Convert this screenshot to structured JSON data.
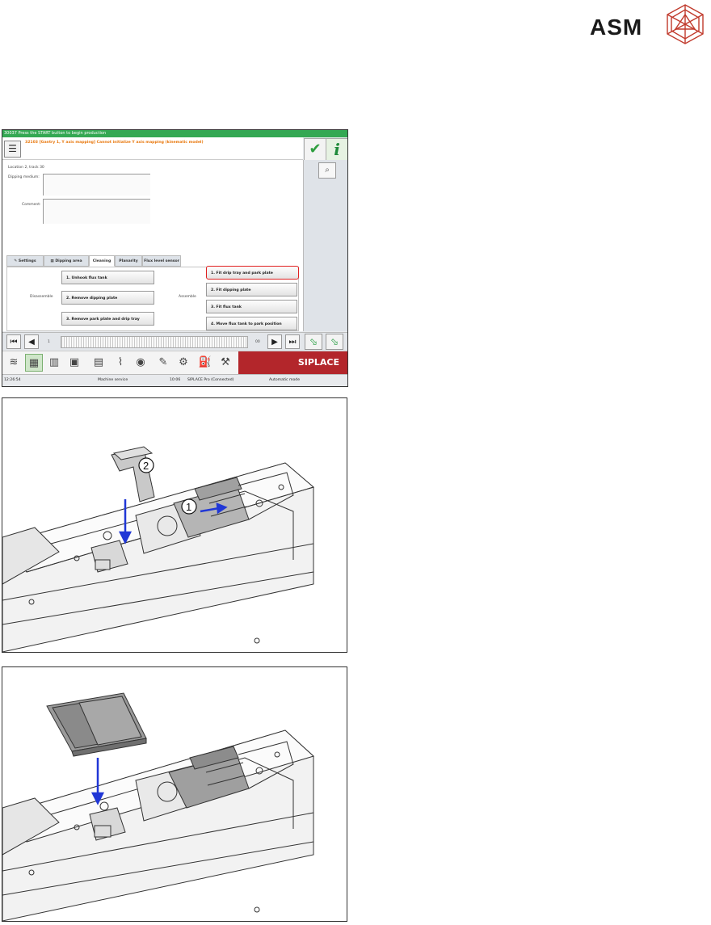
{
  "brand": {
    "name": "ASM",
    "logo_icon": "asm-logo-icon"
  },
  "screen": {
    "status_line": "30037 Press the START button to begin production",
    "message": "32103 [Gantry 1, Y axis mapping] Cannot initialize Y axis mapping (kinematic model)",
    "menu_icon": "hamburger-icon",
    "ok_icon": "check-icon",
    "info_label": "i",
    "zoom_icon": "magnifier-icon",
    "location": "Location 2, track 30",
    "dipping_medium_label": "Dipping medium:",
    "comment_label": "Comment:",
    "tabs": [
      {
        "label": "Settings",
        "icon": "wrench-icon"
      },
      {
        "label": "Dipping area",
        "icon": "tray-icon"
      },
      {
        "label": "Cleaning",
        "active": true
      },
      {
        "label": "Planarity"
      },
      {
        "label": "Flux level sensor"
      }
    ],
    "disassemble_label": "Disassemble",
    "assemble_label": "Assemble",
    "disassemble_buttons": [
      "1. Unhook flux tank",
      "2. Remove dipping plate",
      "3. Remove park plate and drip tray"
    ],
    "assemble_buttons": [
      "1. Fit drip tray and park plate",
      "2. Fit dipping plate",
      "3. Fit flux tank",
      "4. Move flux tank to park position"
    ],
    "nav": {
      "left_value": "1",
      "right_value": "00"
    },
    "siplace_label": "SIPLACE",
    "status": {
      "time": "12:26:54",
      "mode_user": "Machine service",
      "clock2": "10:06",
      "connection": "SIPLACE Pro (Connected)",
      "auto_mode": "Automatic mode"
    }
  },
  "figures": {
    "fig1_callouts": [
      "1",
      "2"
    ]
  }
}
